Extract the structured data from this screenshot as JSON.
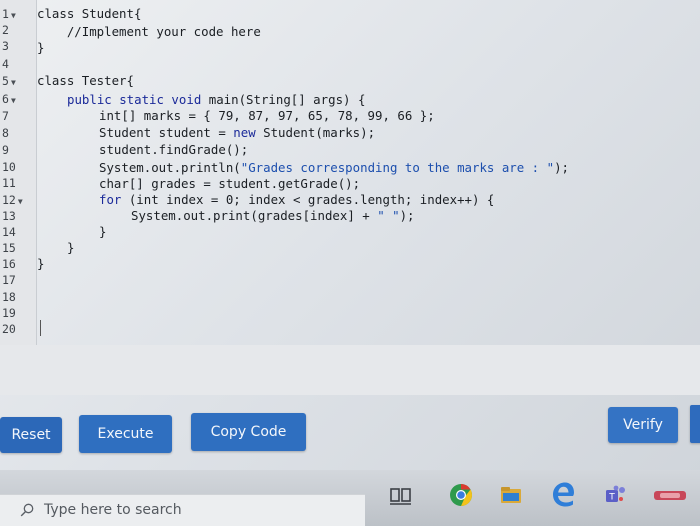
{
  "editor": {
    "line_numbers": [
      "1",
      "2",
      "3",
      "4",
      "5",
      "6",
      "7",
      "8",
      "9",
      "10",
      "11",
      "12",
      "13",
      "14",
      "15",
      "16",
      "17",
      "18",
      "19",
      "20"
    ],
    "foldable_lines": [
      "1",
      "5",
      "6",
      "12"
    ],
    "code": {
      "l1": "class Student{",
      "l2": "    //Implement your code here",
      "l3": "}",
      "l5": "class Tester{",
      "l6a": "public static void ",
      "l6b": "main(String[] args) {",
      "l7": "int[] marks = { 79, 87, 97, 65, 78, 99, 66 };",
      "l8a": "Student student = ",
      "l8b": "new",
      "l8c": " Student(marks);",
      "l9": "student.findGrade();",
      "l10a": "System.out.println(",
      "l10b": "\"Grades corresponding to the marks are : \"",
      "l10c": ");",
      "l11": "char[] grades = student.getGrade();",
      "l12a": "for",
      "l12b": " (int index = 0; index < grades.length; index++) {",
      "l13a": "System.out.print(grades[index] + ",
      "l13b": "\" \"",
      "l13c": ");",
      "l14": "}",
      "l15": "}",
      "l16": "}"
    }
  },
  "buttons": {
    "reset": "Reset",
    "execute": "Execute",
    "copy": "Copy Code",
    "verify": "Verify"
  },
  "taskbar": {
    "search_placeholder": "Type here to search",
    "icons": [
      "task-view-icon",
      "chrome-icon",
      "file-explorer-icon",
      "edge-icon",
      "teams-icon",
      "app-icon"
    ]
  },
  "colors": {
    "button_blue": "#2f6fc0",
    "keyword_blue": "#1b2a99",
    "string_blue": "#1d4fae"
  }
}
